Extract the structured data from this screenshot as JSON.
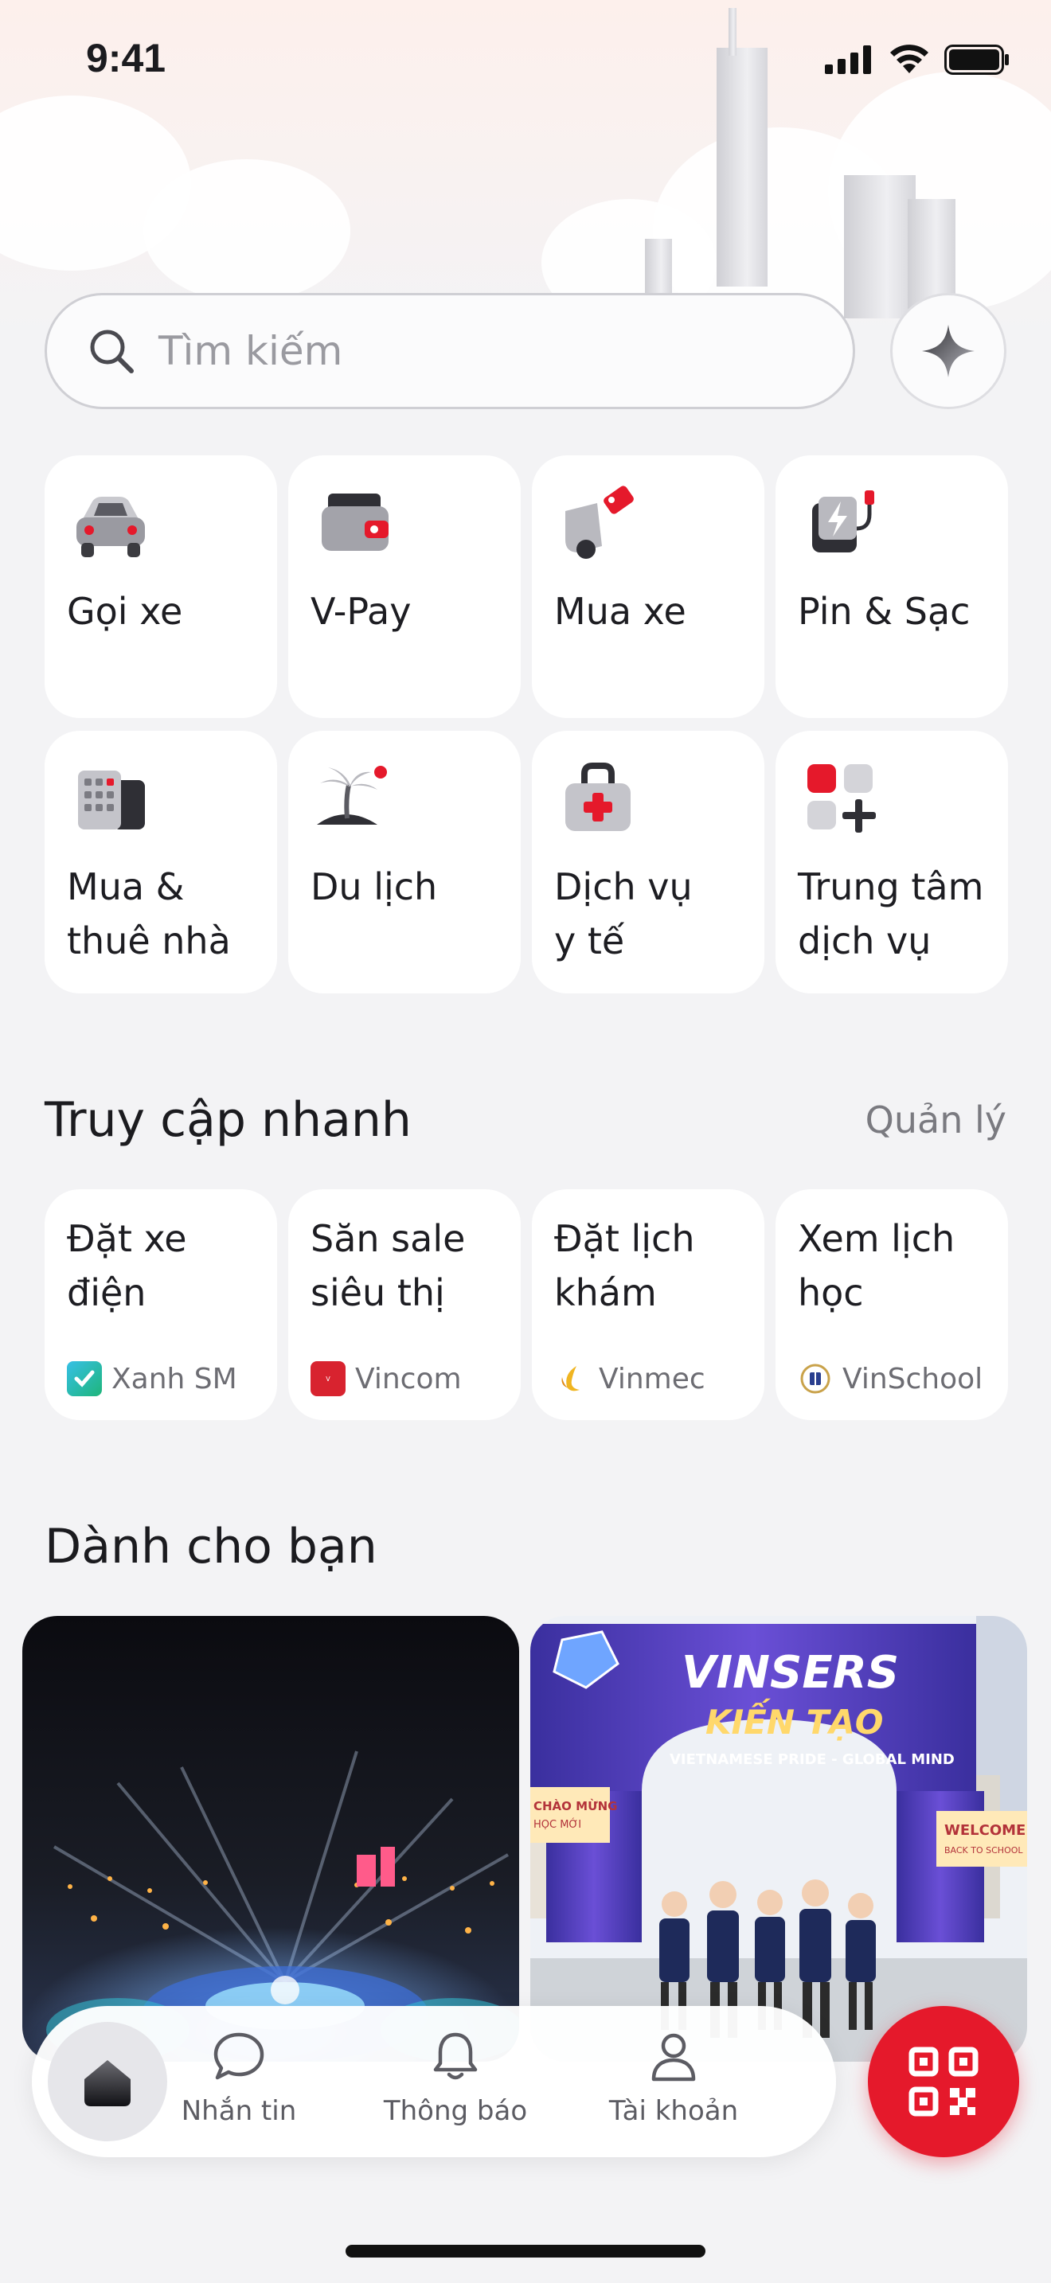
{
  "status_bar": {
    "time": "9:41"
  },
  "search": {
    "placeholder": "Tìm kiếm",
    "ai_icon": "sparkle-icon"
  },
  "services": [
    {
      "label": "Gọi xe",
      "icon": "car-icon"
    },
    {
      "label": "V-Pay",
      "icon": "wallet-icon"
    },
    {
      "label": "Mua xe",
      "icon": "car-tag-icon"
    },
    {
      "label": "Pin & Sạc",
      "icon": "charging-icon"
    },
    {
      "label": "Mua &\nthuê nhà",
      "icon": "building-icon"
    },
    {
      "label": "Du lịch",
      "icon": "island-icon"
    },
    {
      "label": "Dịch vụ\ny tế",
      "icon": "medical-kit-icon"
    },
    {
      "label": "Trung tâm\ndịch vụ",
      "icon": "service-grid-icon"
    }
  ],
  "quick_access": {
    "title": "Truy cập nhanh",
    "manage_label": "Quản lý",
    "items": [
      {
        "title": "Đặt xe\nđiện",
        "brand": "Xanh SM"
      },
      {
        "title": "Săn sale\nsiêu thị",
        "brand": "Vincom"
      },
      {
        "title": "Đặt lịch\nkhám",
        "brand": "Vinmec"
      },
      {
        "title": "Xem lịch\nhọc",
        "brand": "VinSchool"
      }
    ]
  },
  "for_you": {
    "title": "Dành cho bạn",
    "cards": [
      {
        "alt": "fireworks-show-photo"
      },
      {
        "alt": "vinschool-event-photo",
        "banner_top": "VINSERS",
        "banner_main": "KIẾN TẠO",
        "banner_sub": "VIETNAMESE PRIDE - GLOBAL MIND",
        "sign_left": "CHÀO MỪNG\nHỌC MỚI",
        "sign_right": "WELCOME\nBACK TO SCHOOL"
      }
    ]
  },
  "nav": {
    "items": [
      {
        "label": "Nhắn tin",
        "icon": "chat-icon"
      },
      {
        "label": "Thông báo",
        "icon": "bell-icon"
      },
      {
        "label": "Tài khoản",
        "icon": "user-icon"
      }
    ],
    "qr_icon": "qr-code-icon"
  },
  "colors": {
    "accent": "#e5192b",
    "background": "#f3f3f5",
    "tile": "#ffffff"
  }
}
